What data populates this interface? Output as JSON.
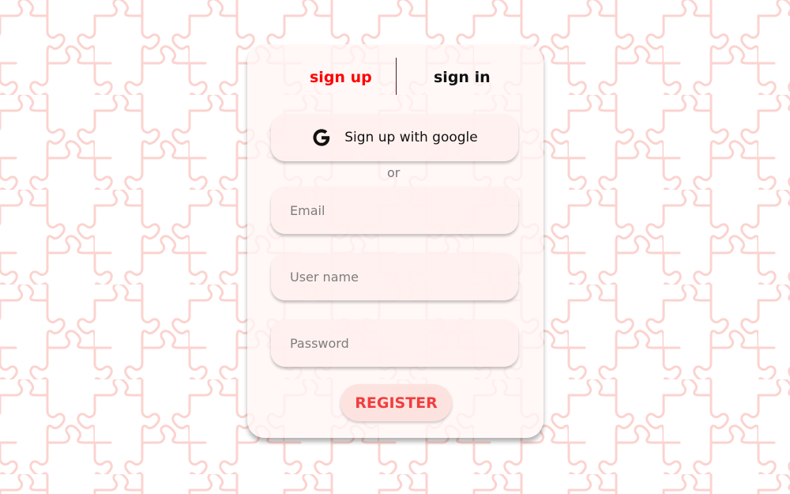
{
  "tabs": {
    "sign_up": "sign up",
    "sign_in": "sign in",
    "active": "sign_up"
  },
  "google_button": {
    "label": "Sign up with google",
    "icon": "google-g-icon"
  },
  "divider_text": "or",
  "form": {
    "email_placeholder": "Email",
    "username_placeholder": "User name",
    "password_placeholder": "Password",
    "email_value": "",
    "username_value": "",
    "password_value": ""
  },
  "register_button": {
    "label": "REGISTER"
  },
  "colors": {
    "accent": "#ff0000",
    "register_text": "#f03e3e",
    "register_bg": "#fde3e0",
    "puzzle_stroke": "#fbd3cf",
    "card_bg": "#fff6f5"
  },
  "background": {
    "pattern": "puzzle-pieces"
  }
}
